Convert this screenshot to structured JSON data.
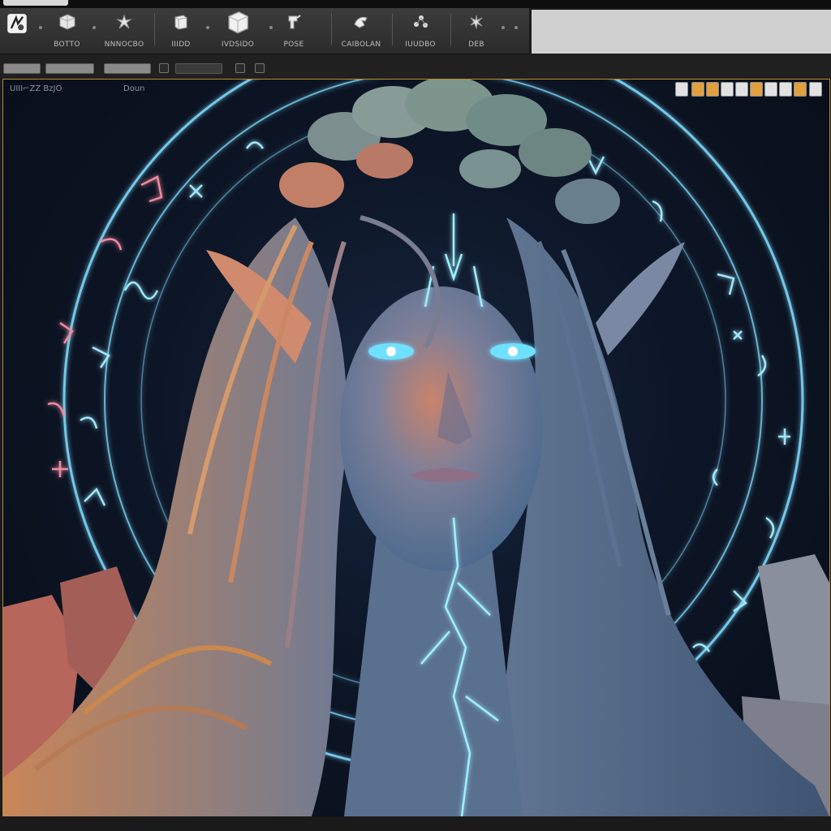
{
  "ribbon": {
    "tools": [
      {
        "label": "",
        "icon": "app-logo-icon"
      },
      {
        "label": "BOTTO",
        "icon": "cube-icon"
      },
      {
        "label": "NNNOCBO",
        "icon": "figure-icon"
      },
      {
        "label": "IIIDD",
        "icon": "cube-icon"
      },
      {
        "label": "IVDSIDO",
        "icon": "box-icon"
      },
      {
        "label": "POSE",
        "icon": "pose-icon"
      },
      {
        "label": "CAIBOLAN",
        "icon": "hand-icon"
      },
      {
        "label": "IUUDBO",
        "icon": "nodes-icon"
      },
      {
        "label": "DEB",
        "icon": "star-icon"
      }
    ]
  },
  "toolbar": {
    "buttons": [
      "",
      "",
      "",
      ""
    ]
  },
  "viewport": {
    "label_left": "UIII⌐ZZ BzJO",
    "label_mid": "Doun"
  },
  "colors": {
    "frame": "#b58a2e",
    "rune_glow": "#6fd6ff",
    "accent_orange": "#e0a040"
  }
}
